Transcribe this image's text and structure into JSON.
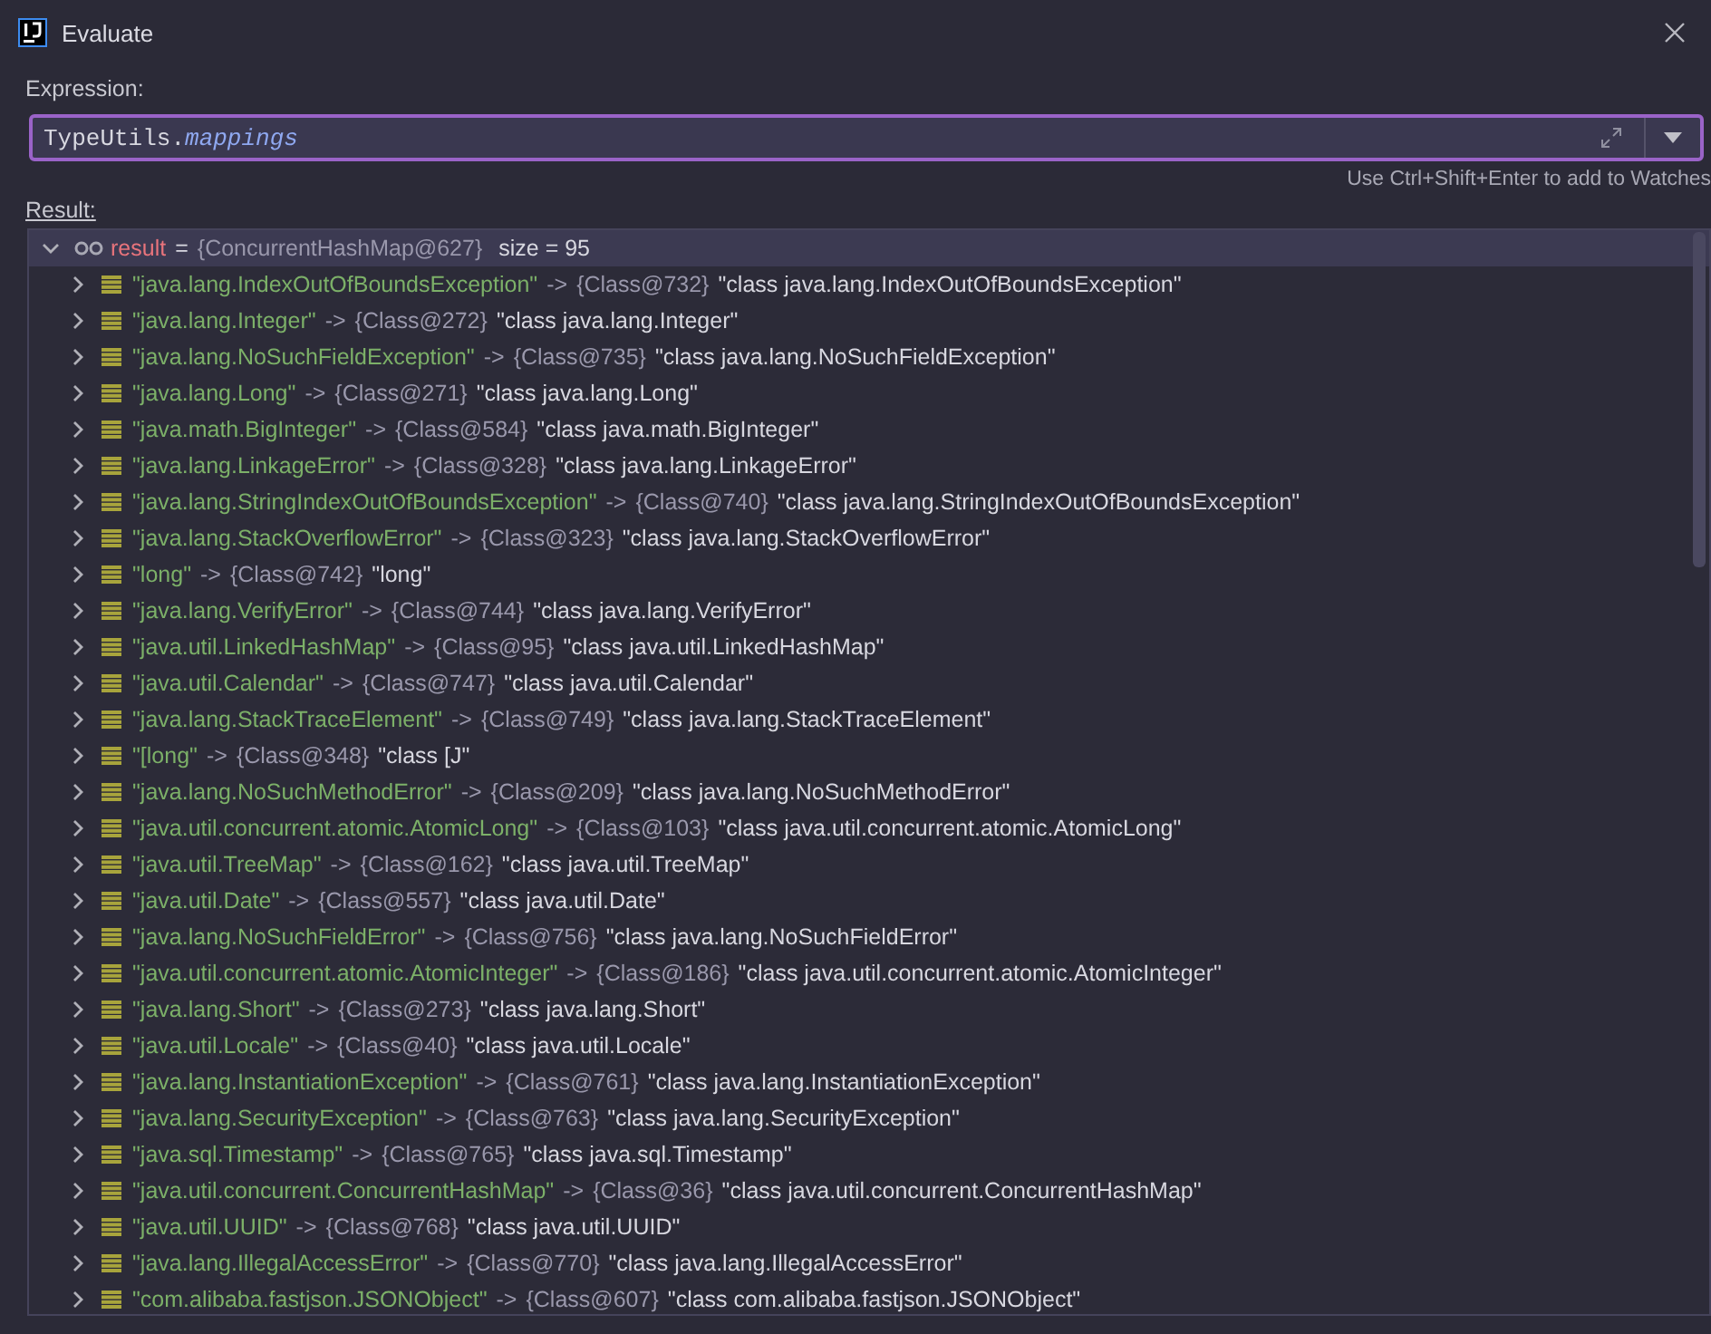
{
  "window": {
    "title": "Evaluate"
  },
  "expression": {
    "label": "Expression:",
    "value_prefix": "TypeUtils.",
    "value_member": "mappings",
    "hint": "Use Ctrl+Shift+Enter to add to Watches"
  },
  "result": {
    "label": "Result:",
    "root": {
      "name": "result",
      "equals": "=",
      "ref": "{ConcurrentHashMap@627}",
      "extra": "size = 95",
      "expanded": true,
      "selected": true
    },
    "entries": [
      {
        "key": "\"java.lang.IndexOutOfBoundsException\"",
        "arrow": "->",
        "ref": "{Class@732}",
        "value": "\"class java.lang.IndexOutOfBoundsException\"",
        "expanded": false
      },
      {
        "key": "\"java.lang.Integer\"",
        "arrow": "->",
        "ref": "{Class@272}",
        "value": "\"class java.lang.Integer\"",
        "expanded": false
      },
      {
        "key": "\"java.lang.NoSuchFieldException\"",
        "arrow": "->",
        "ref": "{Class@735}",
        "value": "\"class java.lang.NoSuchFieldException\"",
        "expanded": false
      },
      {
        "key": "\"java.lang.Long\"",
        "arrow": "->",
        "ref": "{Class@271}",
        "value": "\"class java.lang.Long\"",
        "expanded": false
      },
      {
        "key": "\"java.math.BigInteger\"",
        "arrow": "->",
        "ref": "{Class@584}",
        "value": "\"class java.math.BigInteger\"",
        "expanded": false
      },
      {
        "key": "\"java.lang.LinkageError\"",
        "arrow": "->",
        "ref": "{Class@328}",
        "value": "\"class java.lang.LinkageError\"",
        "expanded": false
      },
      {
        "key": "\"java.lang.StringIndexOutOfBoundsException\"",
        "arrow": "->",
        "ref": "{Class@740}",
        "value": "\"class java.lang.StringIndexOutOfBoundsException\"",
        "expanded": false
      },
      {
        "key": "\"java.lang.StackOverflowError\"",
        "arrow": "->",
        "ref": "{Class@323}",
        "value": "\"class java.lang.StackOverflowError\"",
        "expanded": false
      },
      {
        "key": "\"long\"",
        "arrow": "->",
        "ref": "{Class@742}",
        "value": "\"long\"",
        "expanded": false
      },
      {
        "key": "\"java.lang.VerifyError\"",
        "arrow": "->",
        "ref": "{Class@744}",
        "value": "\"class java.lang.VerifyError\"",
        "expanded": false
      },
      {
        "key": "\"java.util.LinkedHashMap\"",
        "arrow": "->",
        "ref": "{Class@95}",
        "value": "\"class java.util.LinkedHashMap\"",
        "expanded": false
      },
      {
        "key": "\"java.util.Calendar\"",
        "arrow": "->",
        "ref": "{Class@747}",
        "value": "\"class java.util.Calendar\"",
        "expanded": false
      },
      {
        "key": "\"java.lang.StackTraceElement\"",
        "arrow": "->",
        "ref": "{Class@749}",
        "value": "\"class java.lang.StackTraceElement\"",
        "expanded": false
      },
      {
        "key": "\"[long\"",
        "arrow": "->",
        "ref": "{Class@348}",
        "value": "\"class [J\"",
        "expanded": false
      },
      {
        "key": "\"java.lang.NoSuchMethodError\"",
        "arrow": "->",
        "ref": "{Class@209}",
        "value": "\"class java.lang.NoSuchMethodError\"",
        "expanded": false
      },
      {
        "key": "\"java.util.concurrent.atomic.AtomicLong\"",
        "arrow": "->",
        "ref": "{Class@103}",
        "value": "\"class java.util.concurrent.atomic.AtomicLong\"",
        "expanded": false
      },
      {
        "key": "\"java.util.TreeMap\"",
        "arrow": "->",
        "ref": "{Class@162}",
        "value": "\"class java.util.TreeMap\"",
        "expanded": false
      },
      {
        "key": "\"java.util.Date\"",
        "arrow": "->",
        "ref": "{Class@557}",
        "value": "\"class java.util.Date\"",
        "expanded": false
      },
      {
        "key": "\"java.lang.NoSuchFieldError\"",
        "arrow": "->",
        "ref": "{Class@756}",
        "value": "\"class java.lang.NoSuchFieldError\"",
        "expanded": false
      },
      {
        "key": "\"java.util.concurrent.atomic.AtomicInteger\"",
        "arrow": "->",
        "ref": "{Class@186}",
        "value": "\"class java.util.concurrent.atomic.AtomicInteger\"",
        "expanded": false
      },
      {
        "key": "\"java.lang.Short\"",
        "arrow": "->",
        "ref": "{Class@273}",
        "value": "\"class java.lang.Short\"",
        "expanded": false
      },
      {
        "key": "\"java.util.Locale\"",
        "arrow": "->",
        "ref": "{Class@40}",
        "value": "\"class java.util.Locale\"",
        "expanded": false
      },
      {
        "key": "\"java.lang.InstantiationException\"",
        "arrow": "->",
        "ref": "{Class@761}",
        "value": "\"class java.lang.InstantiationException\"",
        "expanded": false
      },
      {
        "key": "\"java.lang.SecurityException\"",
        "arrow": "->",
        "ref": "{Class@763}",
        "value": "\"class java.lang.SecurityException\"",
        "expanded": false
      },
      {
        "key": "\"java.sql.Timestamp\"",
        "arrow": "->",
        "ref": "{Class@765}",
        "value": "\"class java.sql.Timestamp\"",
        "expanded": false
      },
      {
        "key": "\"java.util.concurrent.ConcurrentHashMap\"",
        "arrow": "->",
        "ref": "{Class@36}",
        "value": "\"class java.util.concurrent.ConcurrentHashMap\"",
        "expanded": false
      },
      {
        "key": "\"java.util.UUID\"",
        "arrow": "->",
        "ref": "{Class@768}",
        "value": "\"class java.util.UUID\"",
        "expanded": false
      },
      {
        "key": "\"java.lang.IllegalAccessError\"",
        "arrow": "->",
        "ref": "{Class@770}",
        "value": "\"class java.lang.IllegalAccessError\"",
        "expanded": false
      },
      {
        "key": "\"com.alibaba.fastjson.JSONObject\"",
        "arrow": "->",
        "ref": "{Class@607}",
        "value": "\"class com.alibaba.fastjson.JSONObject\"",
        "expanded": false
      }
    ]
  }
}
